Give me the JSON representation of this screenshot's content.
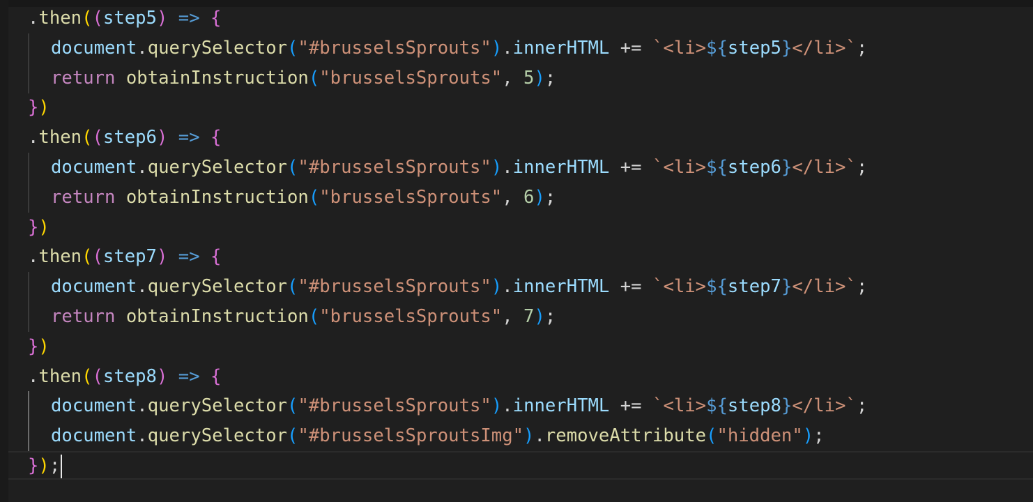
{
  "editor": {
    "theme_colors": {
      "background": "#1f1f1f",
      "function": "#dcdcaa",
      "variable": "#9cdcfe",
      "keyword": "#c586c0",
      "string": "#ce9178",
      "number": "#b5cea8",
      "arrow": "#569cd6",
      "bracket_level_1": "#ffd700",
      "bracket_level_2": "#da70d6",
      "bracket_level_3": "#179fff"
    },
    "tokens": {
      "dot": ".",
      "then": "then",
      "lparen": "(",
      "rparen": ")",
      "arrow": "=>",
      "lbrace": "{",
      "rbrace": "}",
      "document": "document",
      "querySelector": "querySelector",
      "innerHTML": "innerHTML",
      "plus_eq": "+=",
      "return": "return",
      "obtainInstruction": "obtainInstruction",
      "removeAttribute": "removeAttribute",
      "comma": ",",
      "semicolon": ";",
      "backtick": "`",
      "li_open": "<li>",
      "li_close": "</li>",
      "tpl_open": "${",
      "str_sprouts_id": "\"#brusselsSprouts\"",
      "str_sprouts": "\"brusselsSprouts\"",
      "str_sprouts_img_id": "\"#brusselsSproutsImg\"",
      "str_hidden": "\"hidden\""
    },
    "blocks": [
      {
        "param": "step5",
        "next_step": "5"
      },
      {
        "param": "step6",
        "next_step": "6"
      },
      {
        "param": "step7",
        "next_step": "7"
      },
      {
        "param": "step8"
      }
    ]
  }
}
